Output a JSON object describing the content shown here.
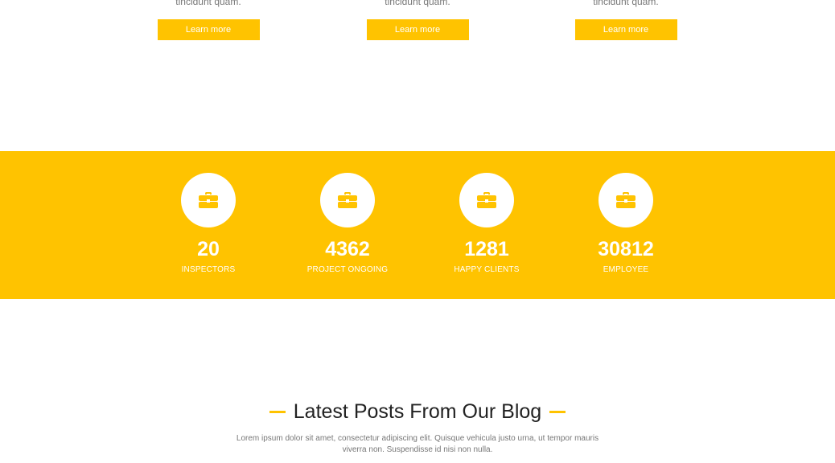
{
  "colors": {
    "accent": "#ffc300",
    "heading": "#222222",
    "body_text": "#777777",
    "white": "#ffffff"
  },
  "services": [
    {
      "text": "tincidunt quam.",
      "button": "Learn more"
    },
    {
      "text": "tincidunt quam.",
      "button": "Learn more"
    },
    {
      "text": "tincidunt quam.",
      "button": "Learn more"
    }
  ],
  "stats": [
    {
      "icon": "briefcase-icon",
      "value": "20",
      "label": "INSPECTORS"
    },
    {
      "icon": "briefcase-icon",
      "value": "4362",
      "label": "PROJECT ONGOING"
    },
    {
      "icon": "briefcase-icon",
      "value": "1281",
      "label": "HAPPY CLIENTS"
    },
    {
      "icon": "briefcase-icon",
      "value": "30812",
      "label": "EMPLOYEE"
    }
  ],
  "blog": {
    "title": "Latest Posts From Our Blog",
    "subtitle": "Lorem ipsum dolor sit amet, consectetur adipiscing elit. Quisque vehicula justo urna, ut tempor mauris viverra non. Suspendisse id nisi non nulla."
  }
}
